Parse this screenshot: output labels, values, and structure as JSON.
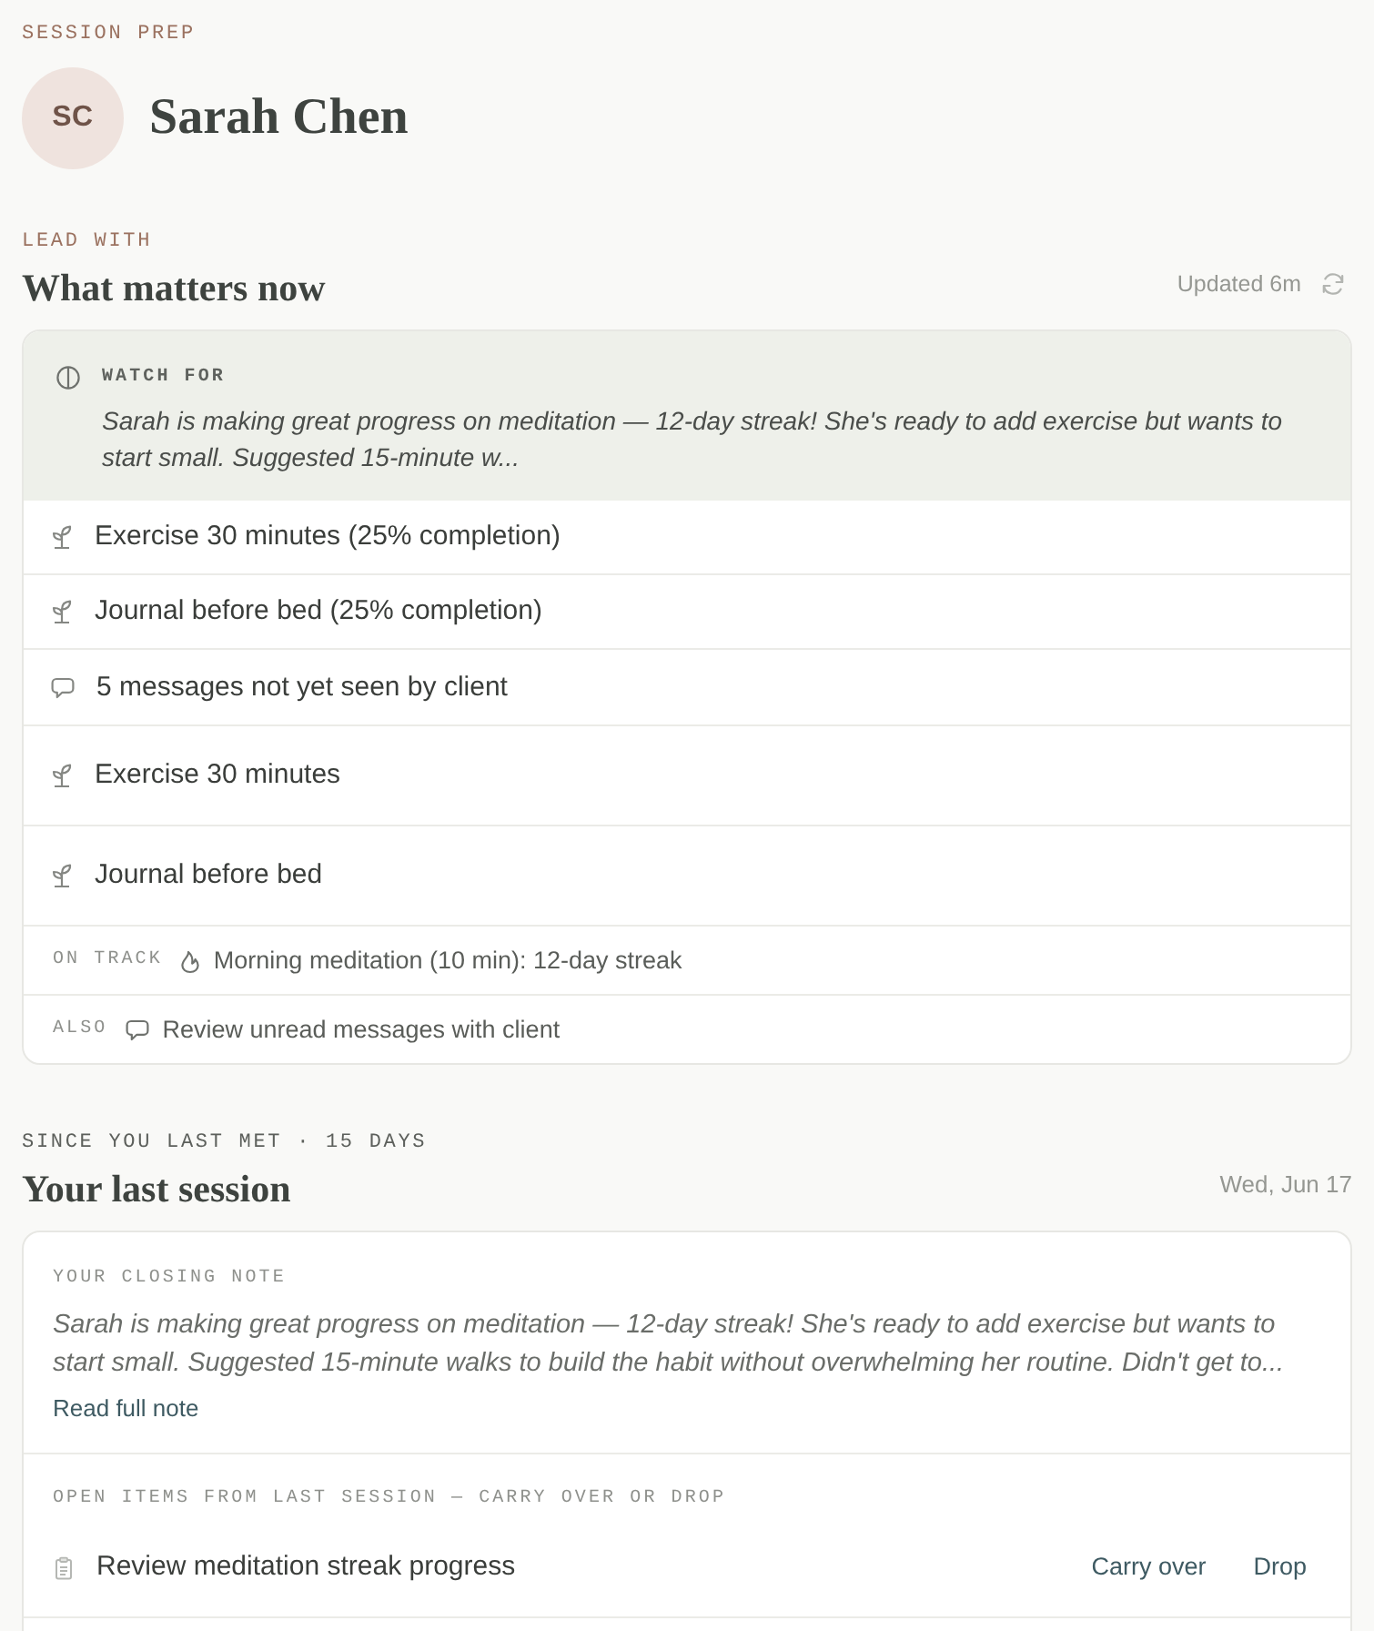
{
  "header": {
    "eyebrow": "SESSION PREP",
    "initials": "SC",
    "name": "Sarah Chen"
  },
  "lead": {
    "eyebrow": "LEAD WITH",
    "title": "What matters now",
    "updated": "Updated 6m"
  },
  "watch_for": {
    "label": "WATCH FOR",
    "text": "Sarah is making great progress on meditation — 12-day streak! She's ready to add exercise but wants to start small. Suggested 15-minute w..."
  },
  "items": [
    {
      "kind": "habit",
      "text": "Exercise 30 minutes (25% completion)"
    },
    {
      "kind": "habit",
      "text": "Journal before bed (25% completion)"
    },
    {
      "kind": "message",
      "text": "5 messages not yet seen by client"
    },
    {
      "kind": "goal",
      "text": "Exercise 30 minutes"
    },
    {
      "kind": "goal",
      "text": "Journal before bed"
    }
  ],
  "summary_rows": [
    {
      "kind": "streak",
      "label": "ON TRACK",
      "text": "Morning meditation (10 min): 12-day streak"
    },
    {
      "kind": "message",
      "label": "ALSO",
      "text": "Review unread messages with client"
    }
  ],
  "last_session": {
    "eyebrow": "SINCE YOU LAST MET · 15 DAYS",
    "title": "Your last session",
    "date": "Wed, Jun 17"
  },
  "closing_note": {
    "label": "YOUR CLOSING NOTE",
    "text": "Sarah is making great progress on meditation — 12-day streak! She's ready to add exercise but wants to start small. Suggested 15-minute walks to build the habit without overwhelming her routine. Didn't get to...",
    "link": "Read full note"
  },
  "open_items": {
    "label": "OPEN ITEMS FROM LAST SESSION — CARRY OVER OR DROP",
    "items": [
      {
        "text": "Review meditation streak progress",
        "actions": [
          "Carry over",
          "Drop"
        ]
      }
    ]
  }
}
